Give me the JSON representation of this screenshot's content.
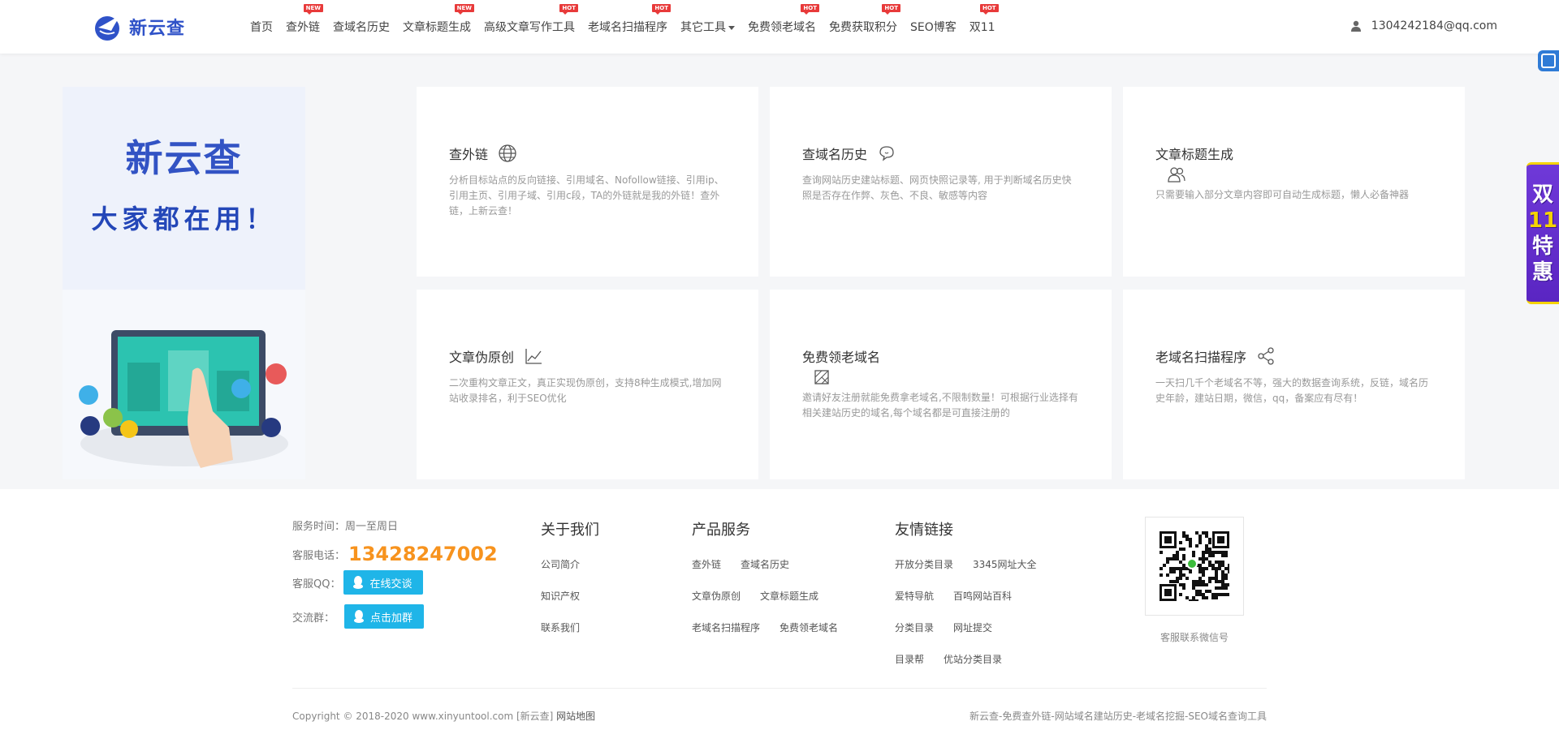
{
  "header": {
    "logo_text": "新云查",
    "nav": [
      {
        "label": "首页",
        "badge": ""
      },
      {
        "label": "查外链",
        "badge": "NEW"
      },
      {
        "label": "查域名历史",
        "badge": ""
      },
      {
        "label": "文章标题生成",
        "badge": "NEW"
      },
      {
        "label": "高级文章写作工具",
        "badge": "HOT"
      },
      {
        "label": "老域名扫描程序",
        "badge": "HOT"
      },
      {
        "label": "其它工具",
        "badge": ""
      },
      {
        "label": "免费领老域名",
        "badge": "HOT"
      },
      {
        "label": "免费获取积分",
        "badge": "HOT"
      },
      {
        "label": "SEO博客",
        "badge": ""
      },
      {
        "label": "双11",
        "badge": "HOT"
      }
    ],
    "user_email": "1304242184@qq.com"
  },
  "promo": {
    "chars": [
      "双",
      "11",
      "特",
      "惠"
    ]
  },
  "banner": {
    "title": "新云查",
    "subtitle": "大家都在用！"
  },
  "cards": [
    {
      "title": "查外链",
      "icon": "globe-icon",
      "desc": "分析目标站点的反向链接、引用域名、Nofollow链接、引用ip、引用主页、引用子域、引用c段，TA的外链就是我的外链！查外链，上新云查！"
    },
    {
      "title": "查域名历史",
      "icon": "chat-bubble-icon",
      "desc": "查询网站历史建站标题、网页快照记录等, 用于判断域名历史快照是否存在作弊、灰色、不良、敏感等内容"
    },
    {
      "title": "文章标题生成",
      "icon": "users-icon",
      "desc": "只需要输入部分文章内容即可自动生成标题，懒人必备神器"
    },
    {
      "title": "文章伪原创",
      "icon": "line-chart-icon",
      "desc": "二次重构文章正文，真正实现伪原创，支持8种生成模式,增加网站收录排名，利于SEO优化"
    },
    {
      "title": "免费领老域名",
      "icon": "hatched-square-icon",
      "desc": "邀请好友注册就能免费拿老域名,不限制数量！可根据行业选择有相关建站历史的域名,每个域名都是可直接注册的"
    },
    {
      "title": "老域名扫描程序",
      "icon": "share-icon",
      "desc": "一天扫几千个老域名不等，强大的数据查询系统，反链，域名历史年龄，建站日期，微信，qq，备案应有尽有！"
    }
  ],
  "footer": {
    "service_time_label": "服务时间：",
    "service_time": "周一至周日",
    "phone_label": "客服电话：",
    "phone": "13428247002",
    "qq_label": "客服QQ：",
    "qq_button": "在线交谈",
    "group_label": "交流群：",
    "group_button": "点击加群",
    "about": {
      "heading": "关于我们",
      "links": [
        "公司简介",
        "知识产权",
        "联系我们"
      ]
    },
    "products": {
      "heading": "产品服务",
      "rows": [
        [
          "查外链",
          "查域名历史"
        ],
        [
          "文章伪原创",
          "文章标题生成"
        ],
        [
          "老域名扫描程序",
          "免费领老域名"
        ]
      ]
    },
    "friends": {
      "heading": "友情链接",
      "rows": [
        [
          "开放分类目录",
          "3345网址大全"
        ],
        [
          "爱特导航",
          "百鸣网站百科"
        ],
        [
          "分类目录",
          "网址提交"
        ],
        [
          "目录帮",
          "优站分类目录"
        ]
      ]
    },
    "qr_caption": "客服联系微信号",
    "copyright": "Copyright © 2018-2020 www.xinyuntool.com [新云查]",
    "sitemap": "网站地图",
    "slogan": "新云查-免费查外链-网站域名建站历史-老域名挖掘-SEO域名查询工具"
  }
}
